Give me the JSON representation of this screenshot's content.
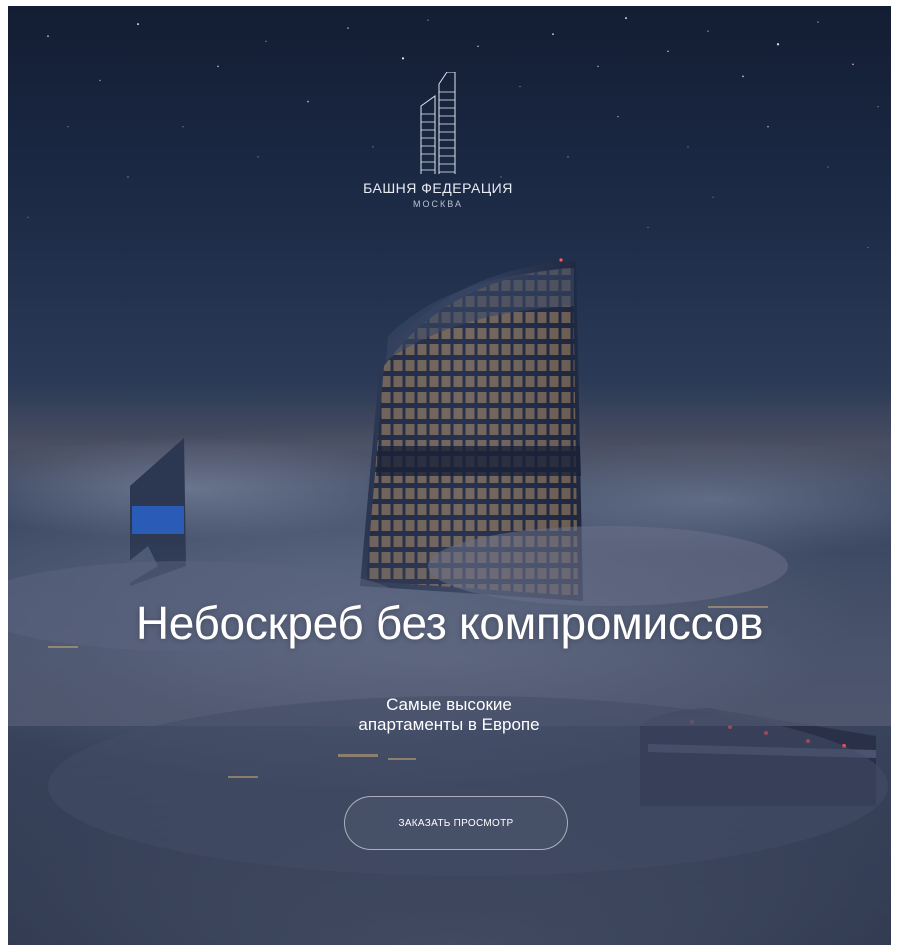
{
  "brand": {
    "name": "БАШНЯ ФЕДЕРАЦИЯ",
    "city": "МОСКВА",
    "logo_icon": "tower-logo-icon"
  },
  "hero": {
    "headline": "Небоскреб без компромиссов",
    "subheadline_line1": "Самые высокие",
    "subheadline_line2": "апартаменты в Европе",
    "cta_label": "ЗАКАЗАТЬ ПРОСМОТР"
  },
  "colors": {
    "text": "#ffffff",
    "sky_top": "#131d33",
    "sky_mid": "#2b3a56",
    "clouds": "#4a5068",
    "window_light": "#e7b879"
  }
}
